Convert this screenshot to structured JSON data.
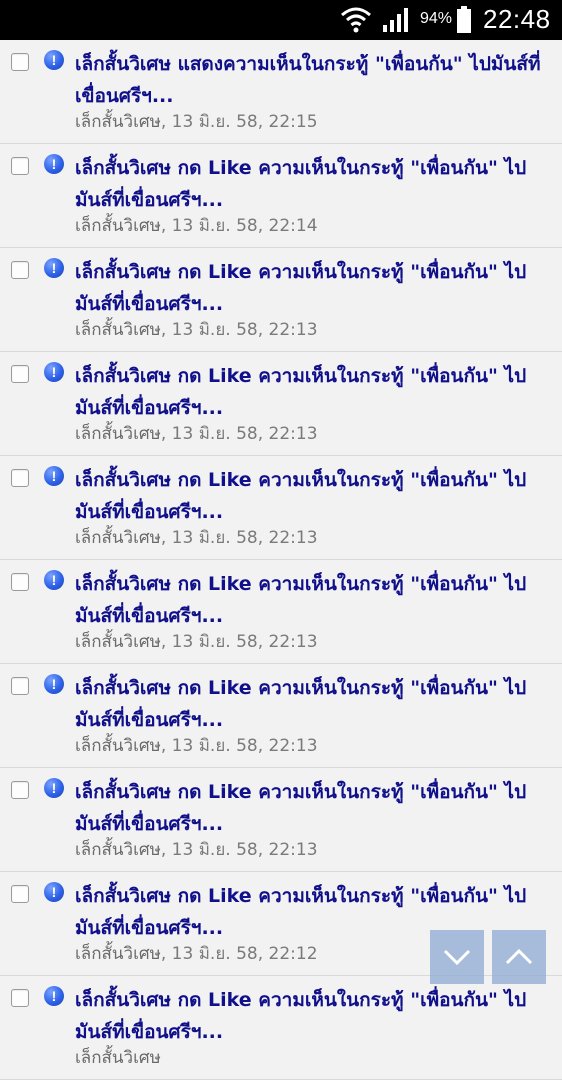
{
  "status_bar": {
    "battery_percent": "94%",
    "time": "22:48",
    "icons": [
      "wifi-icon",
      "signal-icon",
      "battery-icon"
    ]
  },
  "notifications": [
    {
      "title": "เล็กสั้นวิเศษ แสดงความเห็นในกระทู้ \"เพื่อนกัน\" ไปมันส์ที่เขื่อนศรีฯ...",
      "author": "เล็กสั้นวิเศษ",
      "timestamp": ", 13 มิ.ย. 58, 22:15"
    },
    {
      "title": "เล็กสั้นวิเศษ กด Like ความเห็นในกระทู้ \"เพื่อนกัน\" ไปมันส์ที่เขื่อนศรีฯ...",
      "author": "เล็กสั้นวิเศษ",
      "timestamp": ", 13 มิ.ย. 58, 22:14"
    },
    {
      "title": "เล็กสั้นวิเศษ กด Like ความเห็นในกระทู้ \"เพื่อนกัน\" ไปมันส์ที่เขื่อนศรีฯ...",
      "author": "เล็กสั้นวิเศษ",
      "timestamp": ", 13 มิ.ย. 58, 22:13"
    },
    {
      "title": "เล็กสั้นวิเศษ กด Like ความเห็นในกระทู้ \"เพื่อนกัน\" ไปมันส์ที่เขื่อนศรีฯ...",
      "author": "เล็กสั้นวิเศษ",
      "timestamp": ", 13 มิ.ย. 58, 22:13"
    },
    {
      "title": "เล็กสั้นวิเศษ กด Like ความเห็นในกระทู้ \"เพื่อนกัน\" ไปมันส์ที่เขื่อนศรีฯ...",
      "author": "เล็กสั้นวิเศษ",
      "timestamp": ", 13 มิ.ย. 58, 22:13"
    },
    {
      "title": "เล็กสั้นวิเศษ กด Like ความเห็นในกระทู้ \"เพื่อนกัน\" ไปมันส์ที่เขื่อนศรีฯ...",
      "author": "เล็กสั้นวิเศษ",
      "timestamp": ", 13 มิ.ย. 58, 22:13"
    },
    {
      "title": "เล็กสั้นวิเศษ กด Like ความเห็นในกระทู้ \"เพื่อนกัน\" ไปมันส์ที่เขื่อนศรีฯ...",
      "author": "เล็กสั้นวิเศษ",
      "timestamp": ", 13 มิ.ย. 58, 22:13"
    },
    {
      "title": "เล็กสั้นวิเศษ กด Like ความเห็นในกระทู้ \"เพื่อนกัน\" ไปมันส์ที่เขื่อนศรีฯ...",
      "author": "เล็กสั้นวิเศษ",
      "timestamp": ", 13 มิ.ย. 58, 22:13"
    },
    {
      "title": "เล็กสั้นวิเศษ กด Like ความเห็นในกระทู้ \"เพื่อนกัน\" ไปมันส์ที่เขื่อนศรีฯ...",
      "author": "เล็กสั้นวิเศษ",
      "timestamp": ", 13 มิ.ย. 58, 22:12"
    },
    {
      "title": "เล็กสั้นวิเศษ กด Like ความเห็นในกระทู้ \"เพื่อนกัน\" ไปมันส์ที่เขื่อนศรีฯ...",
      "author": "เล็กสั้นวิเศษ",
      "timestamp": ""
    }
  ],
  "colors": {
    "title": "#10108a",
    "meta": "#7a7a7a",
    "background": "#f2f2f2",
    "alert_icon": "#2f62e8",
    "scroll_button": "#8caad2"
  },
  "scroll_buttons": {
    "down_icon": "chevron-down-icon",
    "up_icon": "chevron-up-icon"
  }
}
